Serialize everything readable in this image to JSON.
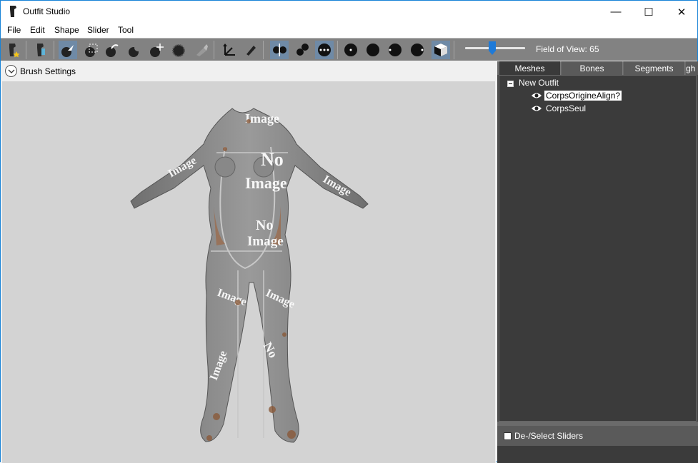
{
  "window": {
    "title": "Outfit Studio",
    "controls": {
      "minimize": "—",
      "maximize": "☐",
      "close": "✕"
    }
  },
  "menu": [
    "File",
    "Edit",
    "Shape",
    "Slider",
    "Tool"
  ],
  "toolbar": {
    "fov_label": "Field of View: 65",
    "fov_value": 65
  },
  "brush_settings": {
    "label": "Brush Settings"
  },
  "viewport": {
    "texture_text": [
      "No",
      "Image"
    ]
  },
  "tabs": [
    "Meshes",
    "Bones",
    "Segments",
    "gh"
  ],
  "tree": {
    "root": "New Outfit",
    "meshes": [
      {
        "label": "CorpsOrigineAlign?",
        "selected": true
      },
      {
        "label": "CorpsSeul",
        "selected": false
      }
    ]
  },
  "sliders": {
    "deselect_label": "De-/Select Sliders"
  },
  "colors": {
    "toolbar": "#828282",
    "panel": "#3b3b3b",
    "accent": "#6f8aa6",
    "mesh": "#8c8c8c"
  }
}
